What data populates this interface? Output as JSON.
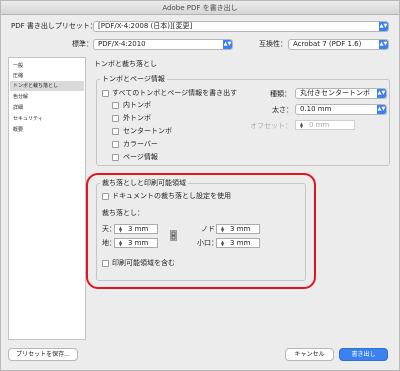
{
  "window": {
    "title": "Adobe PDF を書き出し"
  },
  "top": {
    "preset_label": "PDF 書き出しプリセット：",
    "preset_value": "[PDF/X-4:2008 (日本)][変更]",
    "standard_label": "標準：",
    "standard_value": "PDF/X-4:2010",
    "compat_label": "互換性：",
    "compat_value": "Acrobat 7 (PDF 1.6)"
  },
  "sidebar": {
    "items": [
      {
        "label": "一般"
      },
      {
        "label": "圧縮"
      },
      {
        "label": "トンボと裁ち落とし"
      },
      {
        "label": "色分解"
      },
      {
        "label": "詳細"
      },
      {
        "label": "セキュリティ"
      },
      {
        "label": "概要"
      }
    ]
  },
  "panel": {
    "title": "トンボと裁ち落とし",
    "marks": {
      "group_title": "トンボとページ情報",
      "all_marks": "すべてのトンボとページ情報を書き出す",
      "crop": "内トンボ",
      "outer": "外トンボ",
      "center": "センタートンボ",
      "colorbar": "カラーバー",
      "pageinfo": "ページ情報",
      "type_label": "種類：",
      "type_value": "丸付きセンタートンボ",
      "weight_label": "太さ：",
      "weight_value": "0.10 mm",
      "offset_label": "オフセット：",
      "offset_value": "0 mm"
    },
    "bleed": {
      "group_title": "裁ち落としと印刷可能領域",
      "use_doc": "ドキュメントの裁ち落とし設定を使用",
      "bleed_label": "裁ち落とし：",
      "top_label": "天：",
      "top_value": "3 mm",
      "bottom_label": "地：",
      "bottom_value": "3 mm",
      "inside_label": "ノド：",
      "inside_value": "3 mm",
      "outside_label": "小口：",
      "outside_value": "3 mm",
      "include_slug": "印刷可能領域を含む"
    }
  },
  "footer": {
    "save_preset": "プリセットを保存...",
    "cancel": "キャンセル",
    "export": "書き出し"
  },
  "colors": {
    "accent": "#3b82ef",
    "highlight": "#e0161c"
  }
}
